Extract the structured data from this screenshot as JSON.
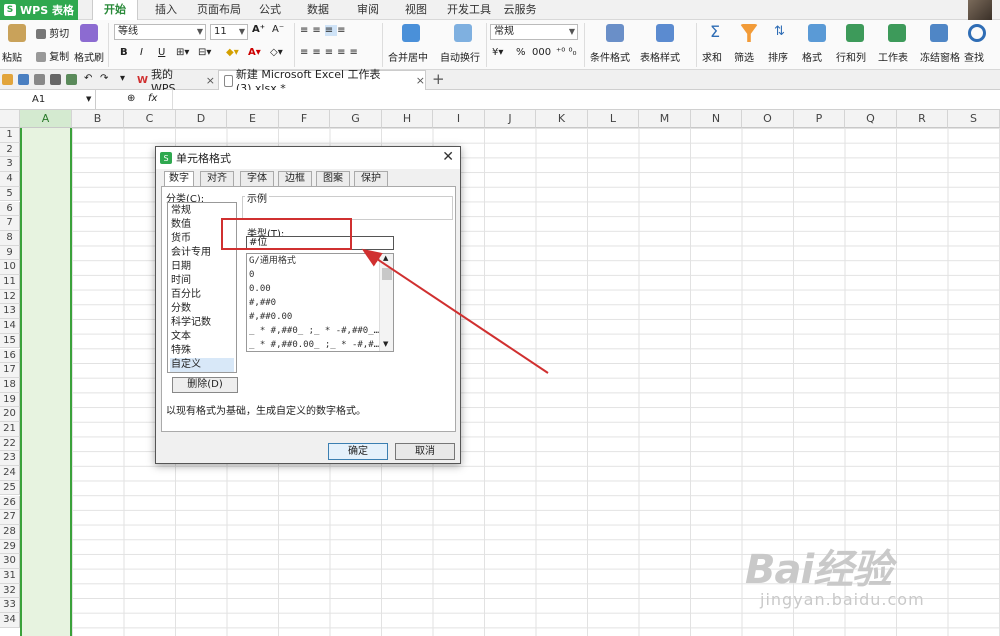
{
  "app": {
    "name": "WPS 表格",
    "logo": "S"
  },
  "menu_tabs": [
    "开始",
    "插入",
    "页面布局",
    "公式",
    "数据",
    "审阅",
    "视图",
    "开发工具",
    "云服务"
  ],
  "ribbon": {
    "paste": "粘贴",
    "cut": "剪切",
    "copy": "复制",
    "format_painter": "格式刷",
    "font_name": "等线",
    "font_size": "11",
    "merge_center": "合并居中",
    "wrap_text": "自动换行",
    "number_format": "常规",
    "percent": "%",
    "conditional_format": "条件格式",
    "table_style": "表格样式",
    "sum": "求和",
    "filter": "筛选",
    "sort": "排序",
    "format": "格式",
    "rows_cols": "行和列",
    "worksheet": "工作表",
    "freeze": "冻结窗格",
    "find": "查找"
  },
  "doc_tabs": {
    "tab1": "我的WPS",
    "tab2": "新建 Microsoft Excel 工作表 (3).xlsx *"
  },
  "formula_bar": {
    "cell_ref": "A1",
    "fx": "fx"
  },
  "columns": [
    "A",
    "B",
    "C",
    "D",
    "E",
    "F",
    "G",
    "H",
    "I",
    "J",
    "K",
    "L",
    "M",
    "N",
    "O",
    "P",
    "Q",
    "R",
    "S"
  ],
  "rows": [
    "1",
    "2",
    "3",
    "4",
    "5",
    "6",
    "7",
    "8",
    "9",
    "10",
    "11",
    "12",
    "13",
    "14",
    "15",
    "16",
    "17",
    "18",
    "19",
    "20",
    "21",
    "22",
    "23",
    "24",
    "25",
    "26",
    "27",
    "28",
    "29",
    "30",
    "31",
    "32",
    "33",
    "34"
  ],
  "dialog": {
    "title": "单元格格式",
    "tabs": [
      "数字",
      "对齐",
      "字体",
      "边框",
      "图案",
      "保护"
    ],
    "category_label": "分类(C):",
    "categories": [
      "常规",
      "数值",
      "货币",
      "会计专用",
      "日期",
      "时间",
      "百分比",
      "分数",
      "科学记数",
      "文本",
      "特殊",
      "自定义"
    ],
    "sample_label": "示例",
    "type_label": "类型(T):",
    "type_value": "#位",
    "format_list": [
      "G/通用格式",
      "0",
      "0.00",
      "#,##0",
      "#,##0.00",
      "_ * #,##0_ ;_ * -#,##0_…",
      "_ * #,##0.00_ ;_ * -#,#…"
    ],
    "delete_button": "删除(D)",
    "hint": "以现有格式为基础，生成自定义的数字格式。",
    "ok": "确定",
    "cancel": "取消"
  },
  "watermark": {
    "brand": "Bai经验",
    "url": "jingyan.baidu.com"
  },
  "colors": {
    "accent": "#2fa84f",
    "annotation": "#d03030",
    "selection": "#e7f3e0"
  }
}
